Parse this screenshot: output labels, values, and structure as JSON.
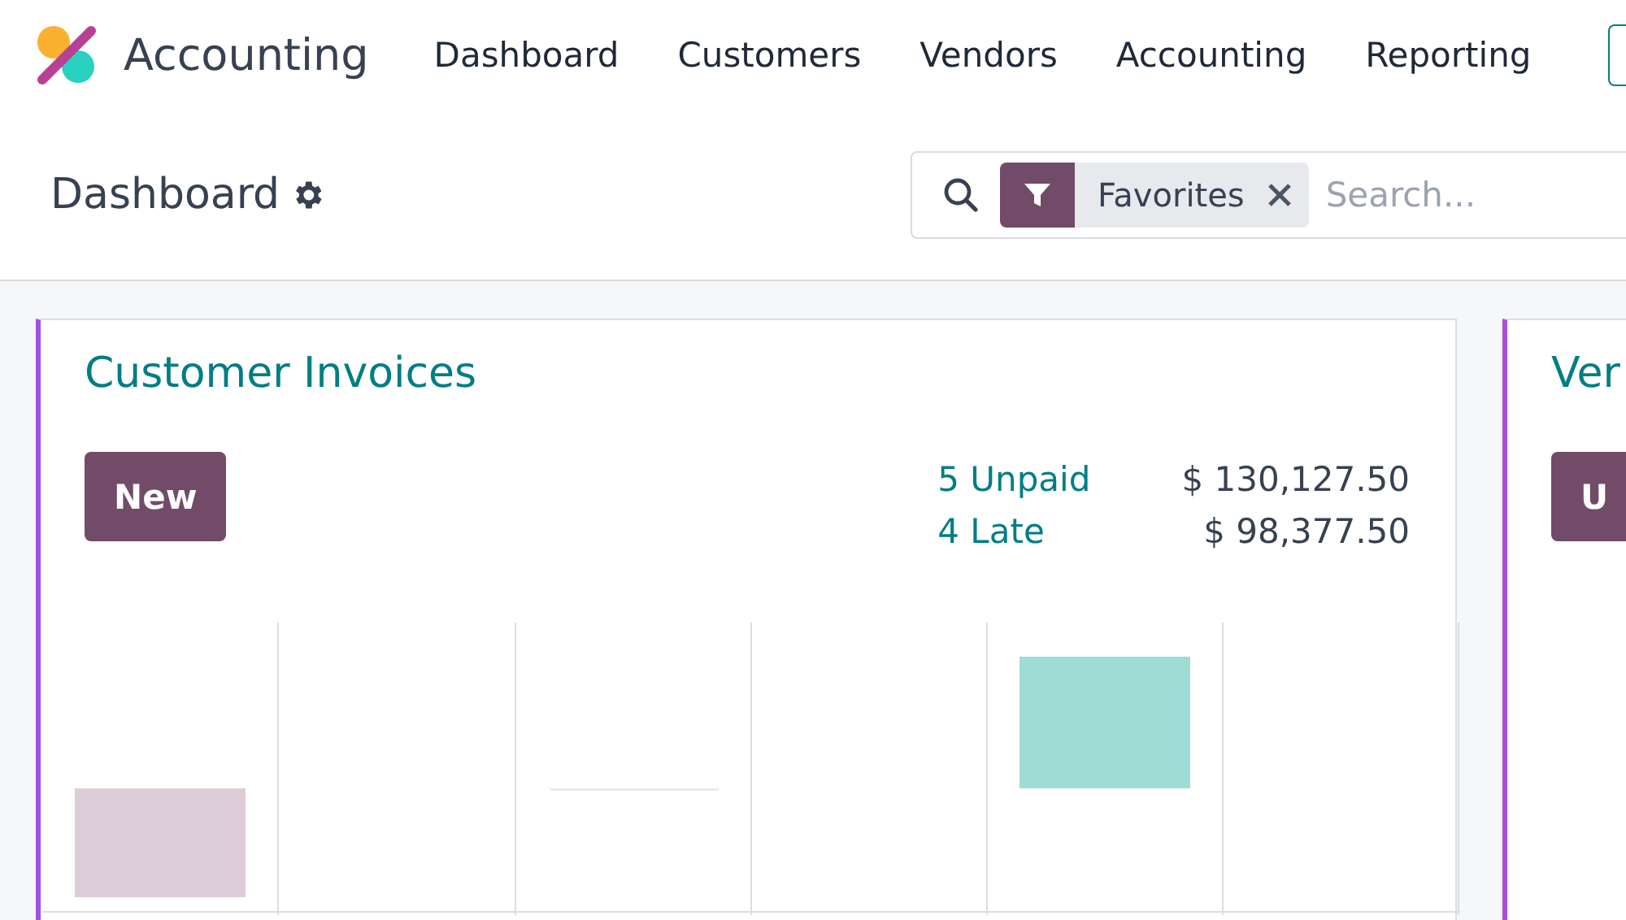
{
  "navbar": {
    "app_name": "Accounting",
    "menu": [
      {
        "label": "Dashboard"
      },
      {
        "label": "Customers"
      },
      {
        "label": "Vendors"
      },
      {
        "label": "Accounting"
      },
      {
        "label": "Reporting"
      }
    ]
  },
  "control_panel": {
    "title": "Dashboard",
    "search": {
      "facet": "Favorites",
      "placeholder": "Search..."
    }
  },
  "cards": [
    {
      "title": "Customer Invoices",
      "button": "New",
      "stats": [
        {
          "label": "5 Unpaid",
          "amount": "$ 130,127.50"
        },
        {
          "label": "4 Late",
          "amount": "$ 98,377.50"
        }
      ]
    },
    {
      "title": "Ver",
      "button": "U"
    }
  ]
}
